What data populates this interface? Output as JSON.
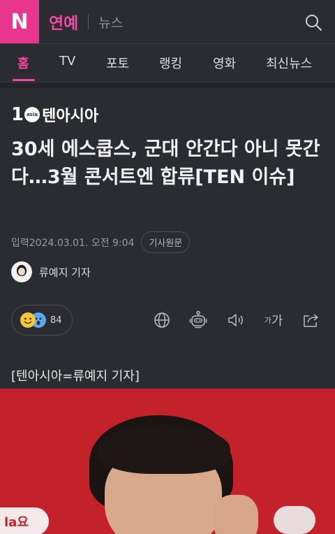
{
  "header": {
    "logo": "N",
    "section": "연예",
    "sub_section": "뉴스"
  },
  "tabs": [
    {
      "label": "홈",
      "active": true
    },
    {
      "label": "TV",
      "active": false
    },
    {
      "label": "포토",
      "active": false
    },
    {
      "label": "랭킹",
      "active": false
    },
    {
      "label": "영화",
      "active": false
    },
    {
      "label": "최신뉴스",
      "active": false
    }
  ],
  "article": {
    "press_mark_digit": "1",
    "press_mark_badge": "asia",
    "press_name": "텐아시아",
    "headline": "30세 에스쿱스, 군대 안간다 아니 못간다…3월 콘서트엔 합류[TEN 이슈]",
    "date_label": "입력2024.03.01. 오전 9:04",
    "original_button": "기사원문",
    "reporter": "류예지 기자",
    "reaction_count": "84",
    "font_tool_small": "가",
    "font_tool_large": "가",
    "caption": "[텐아시아=류예지 기자]"
  },
  "photo": {
    "sign_text": "la요"
  },
  "colors": {
    "accent": "#ee4aa0",
    "logo_bg": "#e8368f",
    "background": "#2b2c31",
    "photo_bg": "#c3222a"
  },
  "icons": {
    "search": "search-icon",
    "translate": "globe-icon",
    "summary": "robot-icon",
    "audio": "speaker-icon",
    "font": "font-size-icon",
    "share": "share-icon"
  }
}
